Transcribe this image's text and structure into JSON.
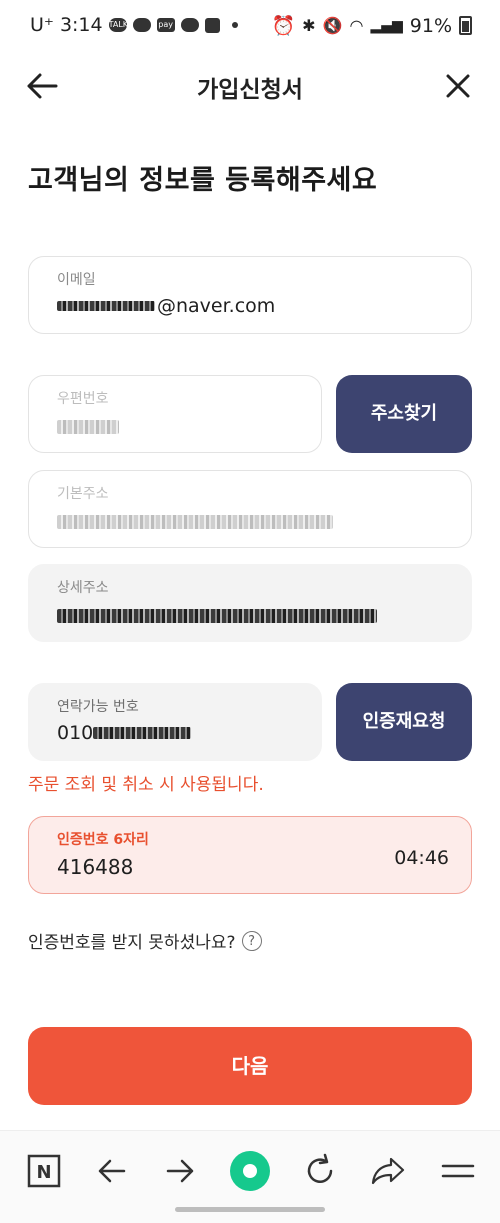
{
  "status_bar": {
    "carrier": "U⁺",
    "time": "3:14",
    "talk_badge": "TALK",
    "pay_badge": "pay",
    "battery": "91%"
  },
  "header": {
    "title": "가입신청서"
  },
  "heading": "고객님의 정보를 등록해주세요",
  "form": {
    "email": {
      "label": "이메일",
      "value_suffix": "@naver.com"
    },
    "postal_code": {
      "label": "우편번호"
    },
    "find_address_label": "주소찾기",
    "basic_address": {
      "label": "기본주소"
    },
    "detail_address": {
      "label": "상세주소"
    },
    "phone": {
      "label": "연락가능 번호",
      "value_prefix": "010"
    },
    "resend_label": "인증재요청",
    "notice": "주문 조회 및 취소 시 사용됩니다.",
    "verification": {
      "label": "인증번호 6자리",
      "value": "416488",
      "timer": "04:46"
    },
    "no_code_text": "인증번호를 받지 못하셨나요?",
    "help_mark": "?"
  },
  "next_label": "다음",
  "bottom_nav": {
    "naver_letter": "N"
  },
  "colors": {
    "navy": "#3d4470",
    "accent": "#ef553a",
    "error_text": "#e8502f",
    "verify_bg": "#fdecea"
  }
}
